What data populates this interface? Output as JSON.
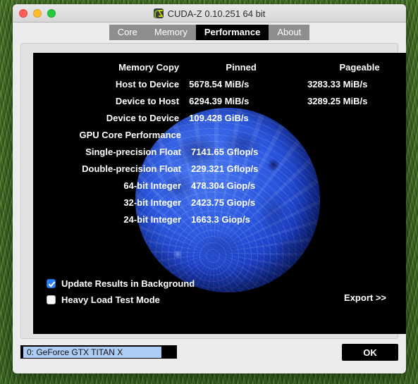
{
  "window": {
    "title": "CUDA-Z 0.10.251 64 bit",
    "app_icon": "cuda-z-logo-icon",
    "traffic_lights": {
      "close": "close-button",
      "minimize": "minimize-button",
      "maximize": "maximize-button"
    }
  },
  "tabs": [
    {
      "label": "Core",
      "active": false
    },
    {
      "label": "Memory",
      "active": false
    },
    {
      "label": "Performance",
      "active": true
    },
    {
      "label": "About",
      "active": false
    }
  ],
  "performance": {
    "memory_copy": {
      "section_label": "Memory Copy",
      "col_pinned": "Pinned",
      "col_pageable": "Pageable",
      "rows": [
        {
          "label": "Host to Device",
          "pinned": "5678.54 MiB/s",
          "pageable": "3283.33 MiB/s"
        },
        {
          "label": "Device to Host",
          "pinned": "6294.39 MiB/s",
          "pageable": "3289.25 MiB/s"
        },
        {
          "label": "Device to Device",
          "pinned": "109.428 GiB/s",
          "pageable": ""
        }
      ]
    },
    "gpu_core": {
      "section_label": "GPU Core Performance",
      "rows": [
        {
          "label": "Single-precision Float",
          "value": "7141.65 Gflop/s"
        },
        {
          "label": "Double-precision Float",
          "value": "229.321 Gflop/s"
        },
        {
          "label": "64-bit Integer",
          "value": "478.304 Giop/s"
        },
        {
          "label": "32-bit Integer",
          "value": "2423.75 Giop/s"
        },
        {
          "label": "24-bit Integer",
          "value": "1663.3 Giop/s"
        }
      ]
    },
    "options": [
      {
        "label": "Update Results in Background",
        "checked": true
      },
      {
        "label": "Heavy Load Test Mode",
        "checked": false
      }
    ],
    "export_label": "Export >>"
  },
  "footer": {
    "device": "0: GeForce GTX TITAN X",
    "ok_label": "OK"
  },
  "colors": {
    "panel_background": "#000000",
    "tab_inactive": "#8e8e8e",
    "tab_active": "#000000",
    "checkbox_checked": "#2d7ef9",
    "selection_highlight": "#aecdf5",
    "window_chrome": "#ececec",
    "moon_blue": "#2a56e0"
  }
}
